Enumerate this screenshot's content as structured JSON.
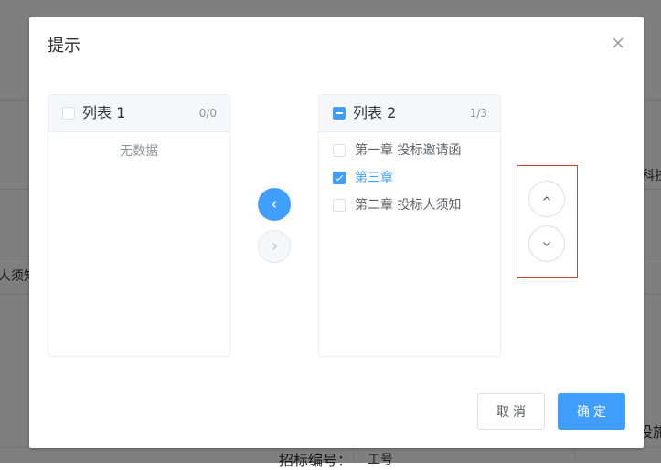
{
  "background": {
    "left_text": "人须知",
    "right_text_1": "科技",
    "right_text_2": "设施",
    "bottom_label": "招标编号：",
    "bottom_value": "工号"
  },
  "dialog": {
    "title": "提示"
  },
  "left_panel": {
    "title": "列表 1",
    "count": "0/0",
    "empty_text": "无数据"
  },
  "right_panel": {
    "title": "列表 2",
    "count": "1/3",
    "items": [
      {
        "label": "第一章 投标邀请函",
        "checked": false
      },
      {
        "label": "第三章",
        "checked": true
      },
      {
        "label": "第二章 投标人须知",
        "checked": false
      }
    ]
  },
  "footer": {
    "cancel_label": "取消",
    "ok_label": "确定"
  },
  "colors": {
    "primary": "#409eff",
    "highlight_border": "#e23c2a"
  }
}
